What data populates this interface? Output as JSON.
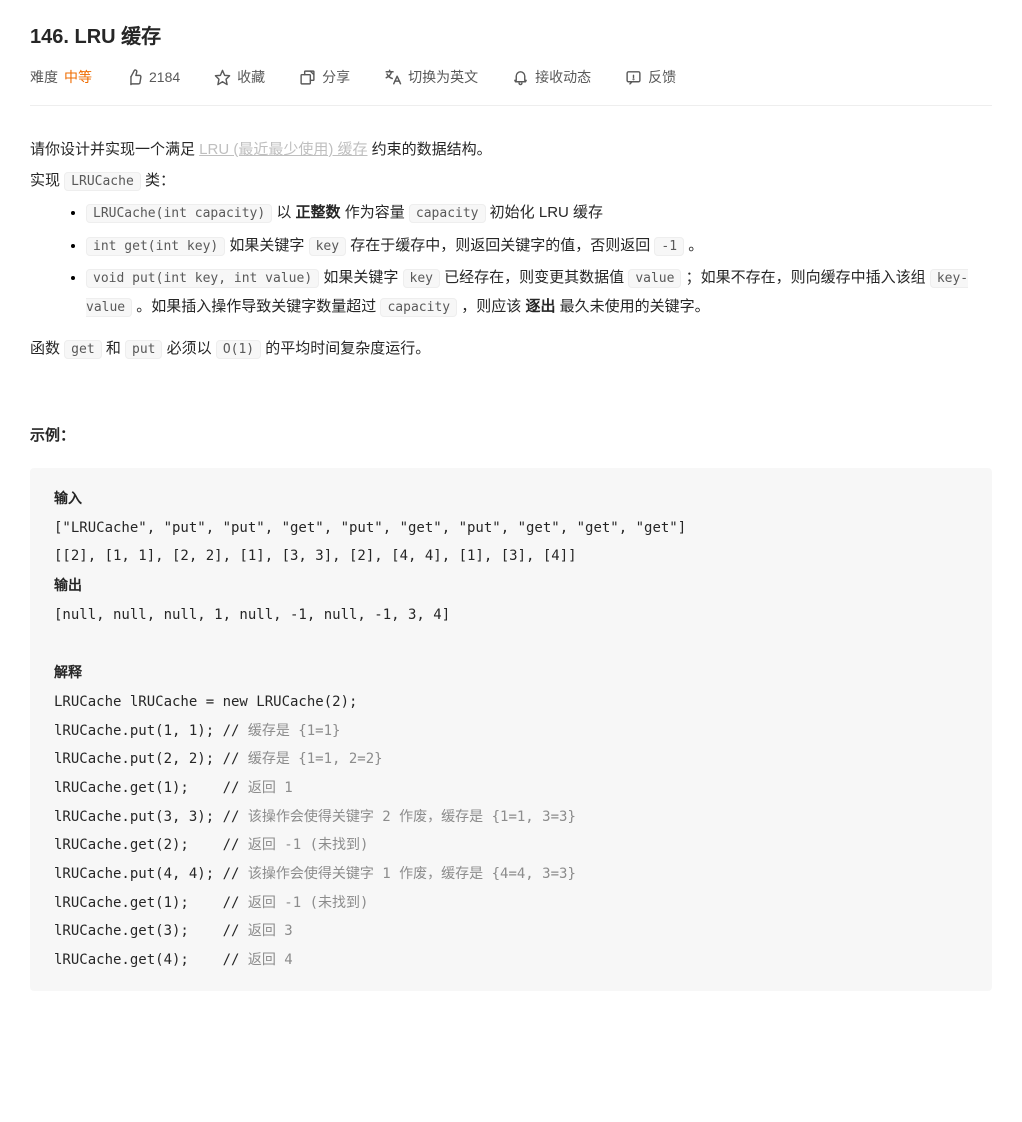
{
  "title": "146. LRU 缓存",
  "toolbar": {
    "difficulty_label": "难度",
    "difficulty_value": "中等",
    "likes": "2184",
    "favorite": "收藏",
    "share": "分享",
    "switch_lang": "切换为英文",
    "subscribe": "接收动态",
    "feedback": "反馈"
  },
  "desc": {
    "p1_a": "请你设计并实现一个满足 ",
    "p1_link": "LRU (最近最少使用) 缓存",
    "p1_b": " 约束的数据结构。",
    "p2_a": "实现 ",
    "p2_code": "LRUCache",
    "p2_b": " 类：",
    "li1": {
      "c1": "LRUCache(int capacity)",
      "t1": " 以 ",
      "bold": "正整数",
      "t2": " 作为容量 ",
      "c2": "capacity",
      "t3": " 初始化 LRU 缓存"
    },
    "li2": {
      "c1": "int get(int key)",
      "t1": " 如果关键字 ",
      "c2": "key",
      "t2": " 存在于缓存中，则返回关键字的值，否则返回 ",
      "c3": "-1",
      "t3": " 。"
    },
    "li3": {
      "c1": "void put(int key, int value)",
      "t1": " 如果关键字 ",
      "c2": "key",
      "t2": " 已经存在，则变更其数据值 ",
      "c3": "value",
      "t3": " ；如果不存在，则向缓存中插入该组 ",
      "c4": "key-value",
      "t4": " 。如果插入操作导致关键字数量超过 ",
      "c5": "capacity",
      "t5": " ，则应该 ",
      "bold": "逐出",
      "t6": " 最久未使用的关键字。"
    },
    "p3_a": "函数 ",
    "p3_c1": "get",
    "p3_b": " 和 ",
    "p3_c2": "put",
    "p3_c": " 必须以 ",
    "p3_c3": "O(1)",
    "p3_d": " 的平均时间复杂度运行。"
  },
  "example_label": "示例：",
  "example": {
    "input_label": "输入",
    "input_l1": "[\"LRUCache\", \"put\", \"put\", \"get\", \"put\", \"get\", \"put\", \"get\", \"get\", \"get\"]",
    "input_l2": "[[2], [1, 1], [2, 2], [1], [3, 3], [2], [4, 4], [1], [3], [4]]",
    "output_label": "输出",
    "output_l1": "[null, null, null, 1, null, -1, null, -1, 3, 4]",
    "explain_label": "解释",
    "e1": "LRUCache lRUCache = new LRUCache(2);",
    "e2a": "lRUCache.put(1, 1); // ",
    "e2b": "缓存是 {1=1}",
    "e3a": "lRUCache.put(2, 2); // ",
    "e3b": "缓存是 {1=1, 2=2}",
    "e4a": "lRUCache.get(1);    // ",
    "e4b": "返回 1",
    "e5a": "lRUCache.put(3, 3); // ",
    "e5b": "该操作会使得关键字 2 作废，缓存是 {1=1, 3=3}",
    "e6a": "lRUCache.get(2);    // ",
    "e6b": "返回 -1 (未找到)",
    "e7a": "lRUCache.put(4, 4); // ",
    "e7b": "该操作会使得关键字 1 作废，缓存是 {4=4, 3=3}",
    "e8a": "lRUCache.get(1);    // ",
    "e8b": "返回 -1 (未找到)",
    "e9a": "lRUCache.get(3);    // ",
    "e9b": "返回 3",
    "e10a": "lRUCache.get(4);    // ",
    "e10b": "返回 4"
  }
}
